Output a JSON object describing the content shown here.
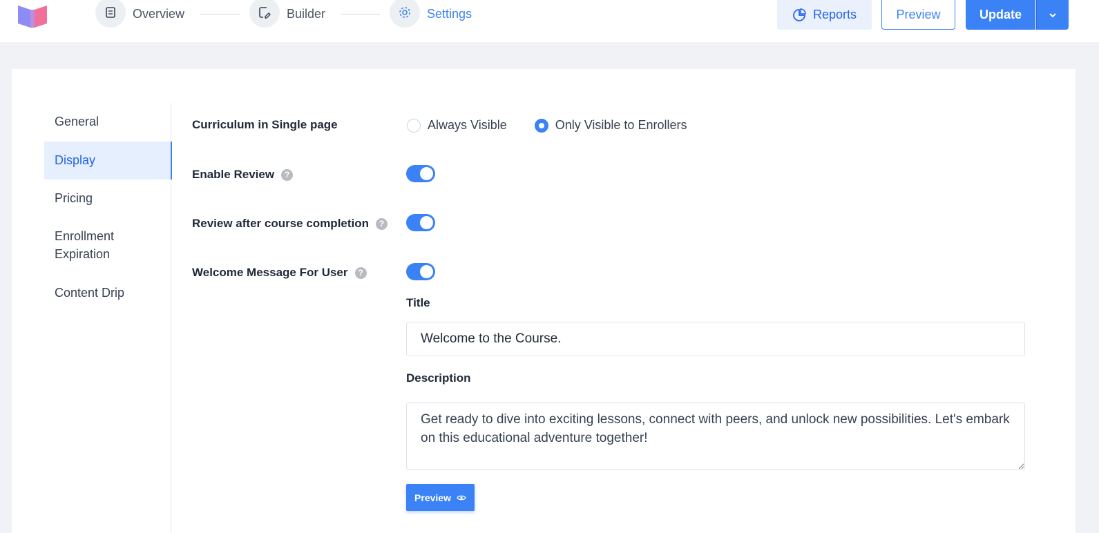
{
  "header": {
    "steps": [
      {
        "label": "Overview",
        "icon": "document-icon",
        "active": false
      },
      {
        "label": "Builder",
        "icon": "edit-icon",
        "active": false
      },
      {
        "label": "Settings",
        "icon": "gear-icon",
        "active": true
      }
    ],
    "reports_label": "Reports",
    "preview_label": "Preview",
    "update_label": "Update"
  },
  "sidebar": {
    "items": [
      {
        "label": "General",
        "active": false
      },
      {
        "label": "Display",
        "active": true
      },
      {
        "label": "Pricing",
        "active": false
      },
      {
        "label": "Enrollment Expiration",
        "active": false
      },
      {
        "label": "Content Drip",
        "active": false
      }
    ]
  },
  "settings": {
    "curriculum": {
      "label": "Curriculum in Single page",
      "options": [
        "Always Visible",
        "Only Visible to Enrollers"
      ],
      "selected": "Only Visible to Enrollers"
    },
    "enable_review": {
      "label": "Enable Review",
      "enabled": true
    },
    "review_after_completion": {
      "label": "Review after course completion",
      "enabled": true
    },
    "welcome_message": {
      "label": "Welcome Message For User",
      "enabled": true
    },
    "title_label": "Title",
    "title_value": "Welcome to the Course.",
    "description_label": "Description",
    "description_value": "Get ready to dive into exciting lessons, connect with peers, and unlock new possibilities. Let's embark on this educational adventure together!",
    "preview_button": "Preview"
  },
  "colors": {
    "accent": "#3b82f6",
    "accent_light": "#e6effe"
  }
}
